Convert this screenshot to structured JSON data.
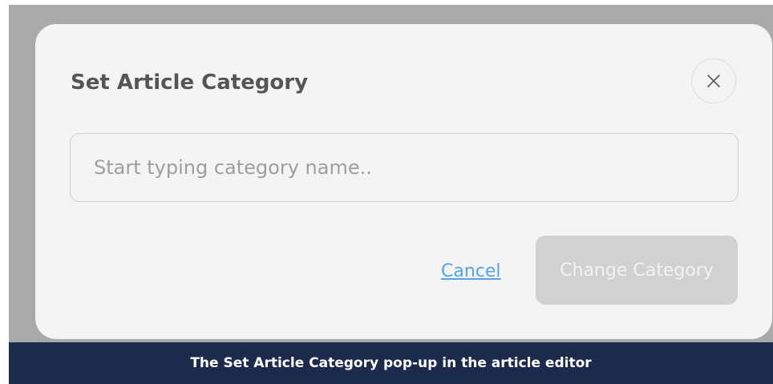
{
  "dialog": {
    "title": "Set Article Category",
    "close_icon": "close-icon",
    "input": {
      "placeholder": "Start typing category name..",
      "value": ""
    },
    "cancel_label": "Cancel",
    "change_label": "Change Category",
    "change_disabled": true
  },
  "caption": {
    "text": "The Set Article Category pop-up in the article editor"
  },
  "colors": {
    "backdrop": "#a9a9a9",
    "modal_background": "#f4f4f4",
    "title_text": "#555555",
    "link": "#55a2e8",
    "disabled_button": "#d1d1d1",
    "caption_bar": "#1c2a4c"
  }
}
